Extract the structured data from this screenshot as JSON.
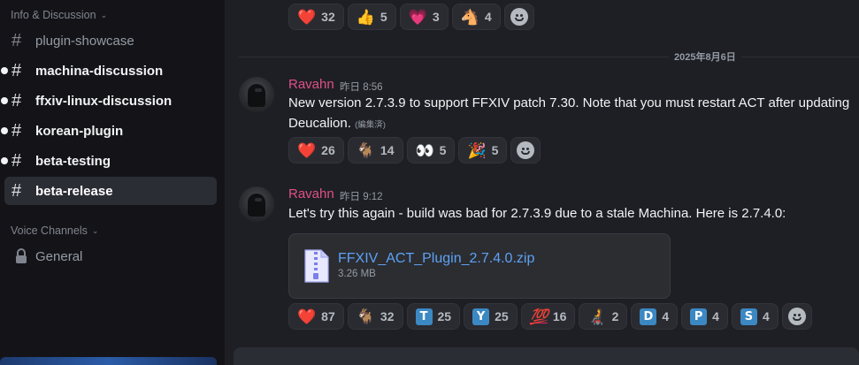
{
  "sidebar": {
    "category_info": "Info & Discussion",
    "channels": [
      {
        "name": "plugin-showcase"
      },
      {
        "name": "machina-discussion"
      },
      {
        "name": "ffxiv-linux-discussion"
      },
      {
        "name": "korean-plugin"
      },
      {
        "name": "beta-testing"
      },
      {
        "name": "beta-release"
      }
    ],
    "category_voice": "Voice Channels",
    "voice_channels": [
      {
        "name": "General"
      }
    ]
  },
  "chat": {
    "top_reactions": [
      {
        "emoji": "❤️",
        "count": "32"
      },
      {
        "emoji": "👍",
        "count": "5"
      },
      {
        "emoji": "💗",
        "count": "3"
      },
      {
        "emoji": "🐴",
        "count": "4"
      }
    ],
    "date_divider": "2025年8月6日",
    "messages": [
      {
        "author": "Ravahn",
        "timestamp": "昨日 8:56",
        "line1": "New version 2.7.3.9 to support FFXIV patch 7.30.  Note that you must restart ACT after updating",
        "line2": "Deucalion.",
        "edited": "(編集済)",
        "reactions": [
          {
            "emoji": "❤️",
            "count": "26"
          },
          {
            "emoji": "🐐",
            "count": "14"
          },
          {
            "emoji": "👀",
            "count": "5"
          },
          {
            "emoji": "🎉",
            "count": "5"
          }
        ]
      },
      {
        "author": "Ravahn",
        "timestamp": "昨日 9:12",
        "line1": "Let's try this again - build was bad for 2.7.3.9 due to a stale Machina.  Here is 2.7.4.0:",
        "attachment": {
          "name": "FFXIV_ACT_Plugin_2.7.4.0.zip",
          "size": "3.26 MB"
        },
        "reactions": [
          {
            "emoji": "❤️",
            "count": "87"
          },
          {
            "emoji": "🐐",
            "count": "32"
          },
          {
            "badge": "T",
            "count": "25"
          },
          {
            "badge": "Y",
            "count": "25"
          },
          {
            "emoji": "💯",
            "count": "16"
          },
          {
            "emoji": "🧑‍🦼",
            "count": "2"
          },
          {
            "badge": "D",
            "count": "4"
          },
          {
            "badge": "P",
            "count": "4"
          },
          {
            "badge": "S",
            "count": "4"
          }
        ]
      }
    ]
  },
  "colors": {
    "author": "#e0508a",
    "link": "#5ea1f5",
    "sidebar_bg": "#141418",
    "chat_bg": "#1e1f24"
  }
}
